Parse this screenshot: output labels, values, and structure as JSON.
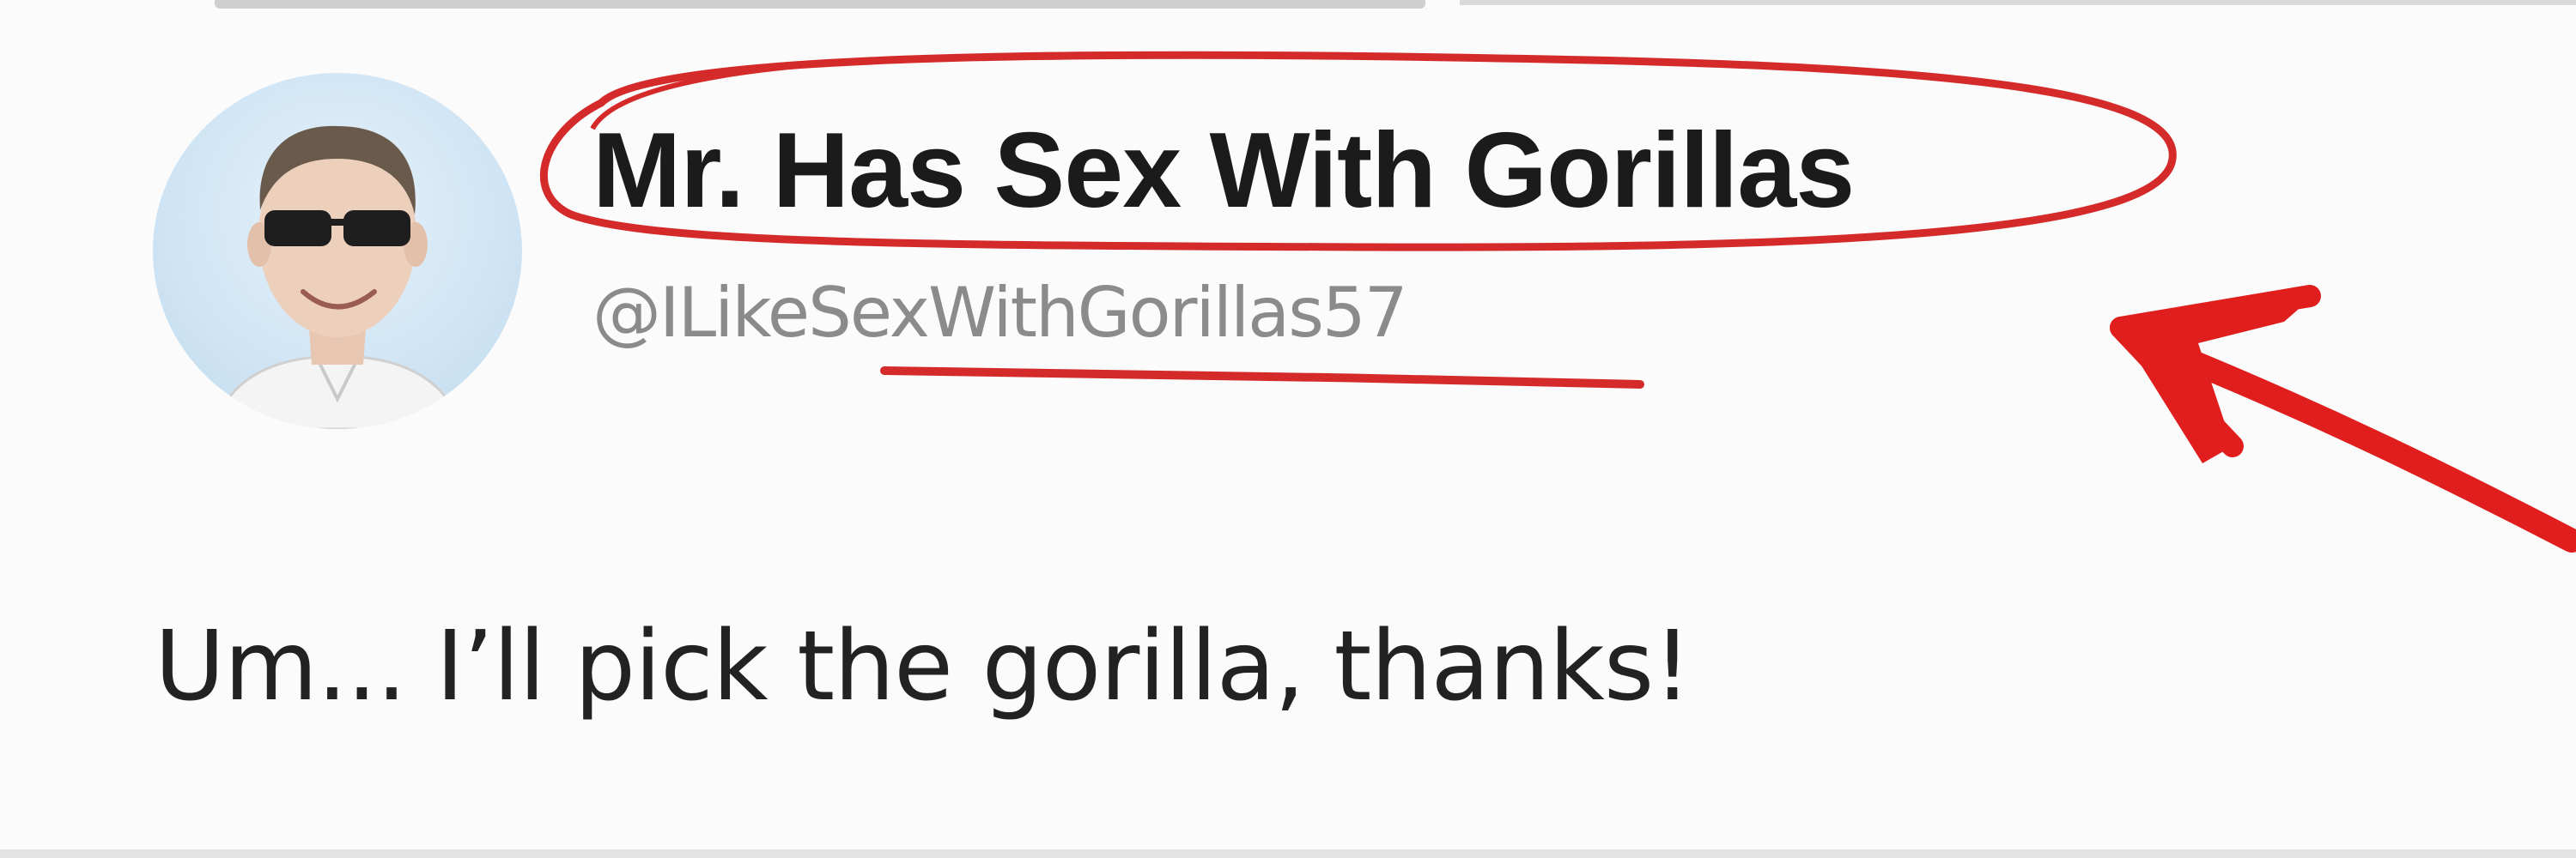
{
  "tweet": {
    "author": {
      "display_name": "Mr. Has Sex With Gorillas",
      "handle": "@ILikeSexWithGorillas57"
    },
    "text": "Um... I’ll pick the gorilla, thanks!"
  },
  "annotations": {
    "color": "#d42a2a",
    "items": [
      "ellipse-around-display-name",
      "underline-under-handle",
      "arrow-pointing-at-display-name"
    ]
  },
  "icons": {
    "avatar": "profile-photo-man-with-sunglasses"
  }
}
